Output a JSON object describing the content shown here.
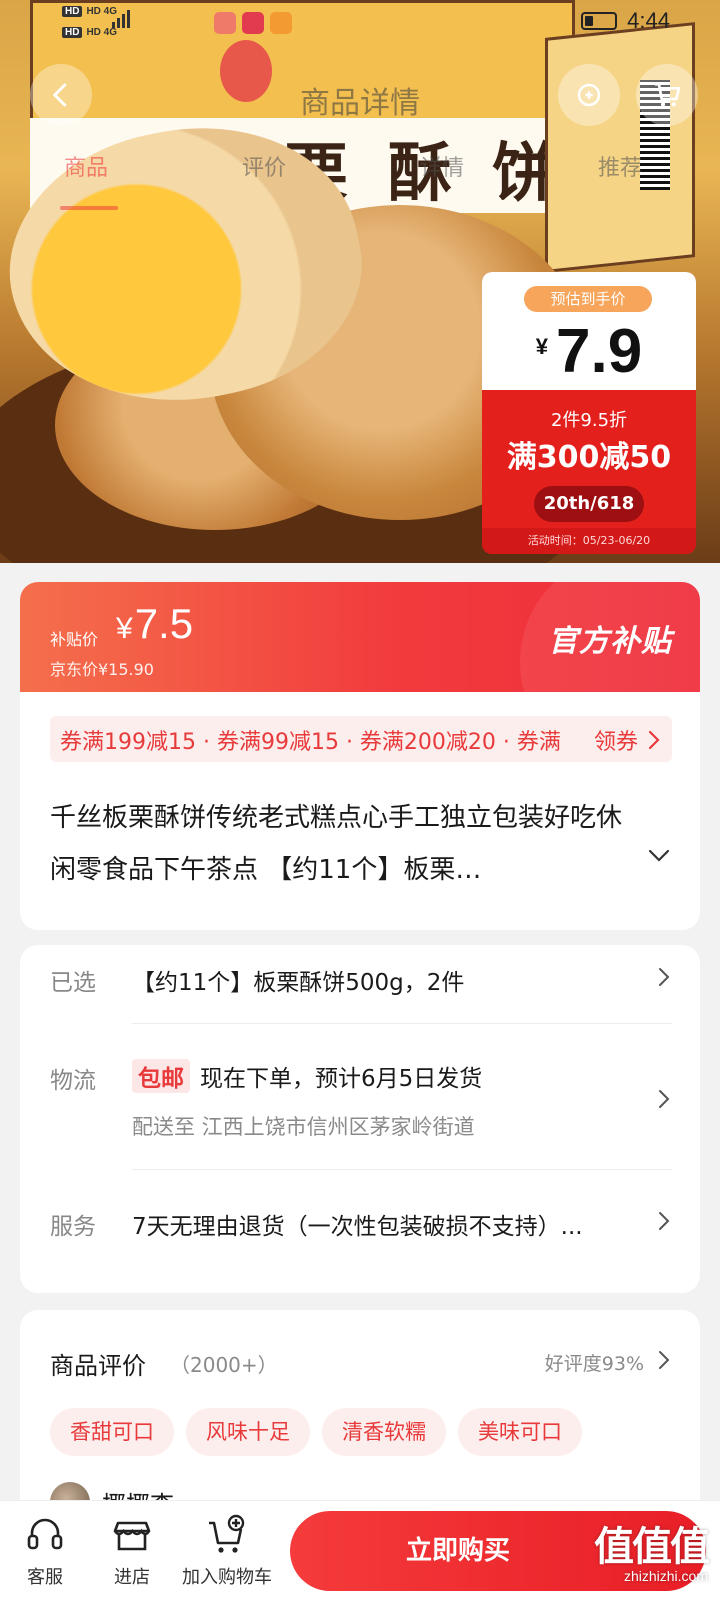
{
  "status_bar": {
    "network_1": "HD 4G",
    "network_2": "HD 4G",
    "time": "4:44"
  },
  "nav": {
    "title": "商品详情",
    "tabs": [
      "商品",
      "评价",
      "详情",
      "推荐"
    ],
    "active_tab_index": 0
  },
  "hero": {
    "box_text": "板栗酥饼",
    "promo": {
      "tag": "预估到手价",
      "currency": "¥",
      "price": "7.9",
      "discount": "2件9.5折",
      "offer": "满300减50",
      "badge": "20th/618",
      "period": "活动时间：05/23-06/20"
    }
  },
  "price_banner": {
    "label": "补贴价",
    "currency": "¥",
    "price": "7.5",
    "jd_price": "京东价¥15.90",
    "official": "官方补贴"
  },
  "product": {
    "coupons": "券满199减15 · 券满99减15 · 券满200减20 · 券满",
    "get_coupon": "领券",
    "title": "千丝板栗酥饼传统老式糕点心手工独立包装好吃休闲零食品下午茶点 【约11个】板栗…"
  },
  "spec": {
    "selected_label": "已选",
    "selected_value": "【约11个】板栗酥饼500g，2件",
    "logistics_label": "物流",
    "free_shipping": "包邮",
    "logistics_value": "现在下单，预计6月5日发货",
    "deliver_to": "配送至  江西上饶市信州区茅家岭街道",
    "service_label": "服务",
    "service_value": "7天无理由退货（一次性包装破损不支持）..."
  },
  "reviews": {
    "title": "商品评价",
    "count": "（2000+）",
    "rating": "好评度93%",
    "tags": [
      "香甜可口",
      "风味十足",
      "清香软糯",
      "美味可口"
    ],
    "first_user": "椰椰李"
  },
  "bottom_bar": {
    "service": "客服",
    "store": "进店",
    "cart": "加入购物车",
    "buy": "立即购买",
    "watermark_big": "值值值",
    "watermark_small": "zhizhizhi.com"
  },
  "colors": {
    "accent_red": "#e83a3a",
    "banner_start": "#f46f4c",
    "banner_end": "#ef2c3a"
  }
}
